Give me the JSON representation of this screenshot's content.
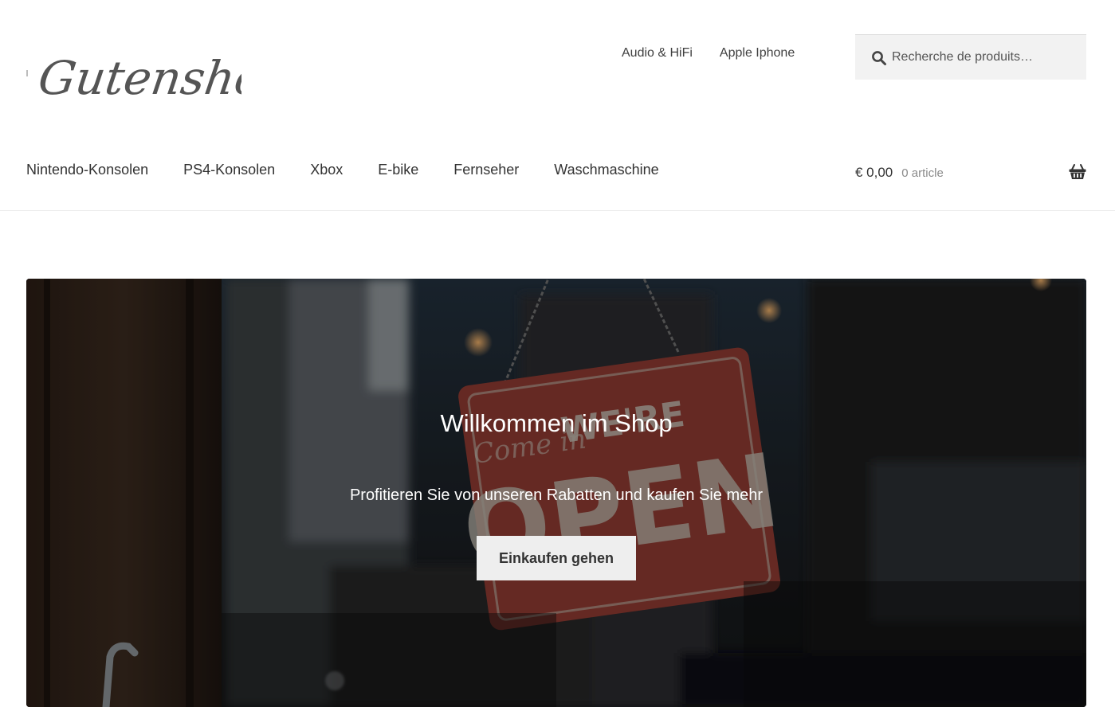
{
  "site": {
    "logo_text": "Gutenshop"
  },
  "secondary_nav": {
    "items": [
      {
        "label": "Audio & HiFi"
      },
      {
        "label": "Apple Iphone"
      }
    ]
  },
  "search": {
    "placeholder": "Recherche de produits…",
    "value": ""
  },
  "primary_nav": {
    "items": [
      {
        "label": "Nintendo-Konsolen"
      },
      {
        "label": "PS4-Konsolen"
      },
      {
        "label": "Xbox"
      },
      {
        "label": "E-bike"
      },
      {
        "label": "Fernseher"
      },
      {
        "label": "Waschmaschine"
      }
    ]
  },
  "cart": {
    "amount": "€ 0,00",
    "count": "0 article"
  },
  "hero": {
    "title": "Willkommen im Shop",
    "subtitle": "Profitieren Sie von unseren Rabatten und kaufen Sie mehr",
    "button_label": "Einkaufen gehen",
    "sign_text_top": "WE'RE",
    "sign_text_main": "OPEN",
    "sign_text_script": "Come in"
  },
  "colors": {
    "text": "#333333",
    "muted": "#8a8a8a",
    "search_bg": "#f2f2f2",
    "button_bg": "#eeeeee",
    "sign_red": "#9a3c33"
  },
  "icons": {
    "search": "search-icon",
    "cart": "basket-icon"
  }
}
